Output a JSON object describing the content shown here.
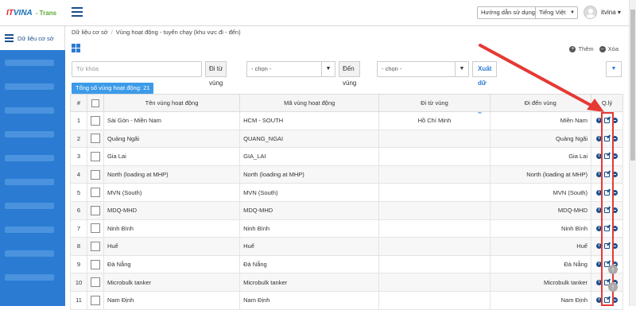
{
  "header": {
    "logo_it": "IT",
    "logo_vina": "VINA",
    "logo_trans": "- Trans",
    "help_label": "Hướng dẫn sử dụng",
    "language": "Tiếng Việt",
    "username": "itvina"
  },
  "sidebar": {
    "active_label": "Dữ liệu cơ sở"
  },
  "breadcrumb": {
    "root": "Dữ liệu cơ sở",
    "current": "Vùng hoạt động - tuyến chạy (khu vực đi - đến)"
  },
  "actions": {
    "add_label": "Thêm",
    "delete_label": "Xóa"
  },
  "filters": {
    "keyword_placeholder": "Từ khóa",
    "from_label": "Đi từ vùng",
    "from_value": "- chọn -",
    "to_label": "Đến vùng",
    "to_value": "- chọn -",
    "export_label": "Xuất dữ liệu"
  },
  "count_badge": "Tổng số vùng hoạt động: 21",
  "table": {
    "headers": {
      "num": "#",
      "name": "Tên vùng hoạt động",
      "code": "Mã vùng hoạt động",
      "from": "Đi từ vùng",
      "to": "Đi đến vùng",
      "manage": "Q.lý"
    },
    "rows": [
      {
        "num": "1",
        "name": "Sài Gòn - Miền Nam",
        "code": "HCM - SOUTH",
        "from": "Hồ Chí Minh",
        "to": "Miền Nam"
      },
      {
        "num": "2",
        "name": "Quảng Ngãi",
        "code": "QUANG_NGAI",
        "from": "",
        "to": "Quảng Ngãi"
      },
      {
        "num": "3",
        "name": "Gia Lai",
        "code": "GIA_LAI",
        "from": "",
        "to": "Gia Lai"
      },
      {
        "num": "4",
        "name": "North (loading at MHP)",
        "code": "North (loading at MHP)",
        "from": "",
        "to": "North (loading at MHP)"
      },
      {
        "num": "5",
        "name": "MVN (South)",
        "code": "MVN (South)",
        "from": "",
        "to": "MVN (South)"
      },
      {
        "num": "6",
        "name": "MDQ-MHD",
        "code": "MDQ-MHD",
        "from": "",
        "to": "MDQ-MHD"
      },
      {
        "num": "7",
        "name": "Ninh Bình",
        "code": "Ninh Bình",
        "from": "",
        "to": "Ninh Bình"
      },
      {
        "num": "8",
        "name": "Huế",
        "code": "Huế",
        "from": "",
        "to": "Huế"
      },
      {
        "num": "9",
        "name": "Đà Nẵng",
        "code": "Đà Nẵng",
        "from": "",
        "to": "Đà Nẵng"
      },
      {
        "num": "10",
        "name": "Microbulk tanker",
        "code": "Microbulk tanker",
        "from": "",
        "to": "Microbulk tanker"
      },
      {
        "num": "11",
        "name": "Nam Định",
        "code": "Nam Định",
        "from": "",
        "to": "Nam Định"
      }
    ]
  },
  "colors": {
    "brand_blue": "#2b7bd3",
    "dark_blue": "#1b4f8a",
    "annotation_red": "#e53935"
  }
}
